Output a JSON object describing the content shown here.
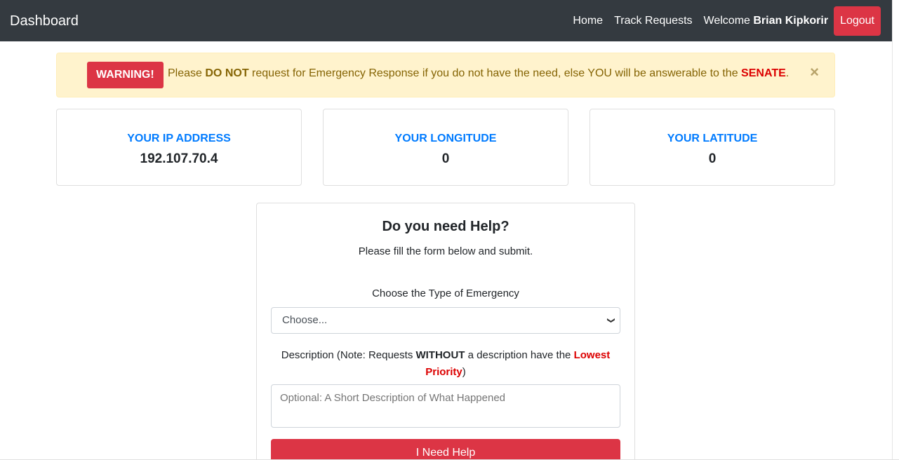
{
  "navbar": {
    "brand": "Dashboard",
    "home": "Home",
    "track": "Track Requests",
    "welcome_prefix": "Welcome",
    "user_name": "Brian Kipkorir",
    "logout": "Logout"
  },
  "alert": {
    "badge": "WARNING!",
    "text_1": "Please ",
    "emphasis_1": "DO NOT",
    "text_2": " request for Emergency Response if you do not have the need, else YOU will be answerable to the ",
    "emphasis_2": "SENATE",
    "text_3": ".",
    "close": "×"
  },
  "stats": [
    {
      "label": "YOUR IP ADDRESS",
      "value": "192.107.70.4"
    },
    {
      "label": "YOUR LONGITUDE",
      "value": "0"
    },
    {
      "label": "YOUR LATITUDE",
      "value": "0"
    }
  ],
  "form": {
    "title": "Do you need Help?",
    "subtitle": "Please fill the form below and submit.",
    "type_label": "Choose the Type of Emergency",
    "type_selected": "Choose...",
    "desc_prefix": "Description (Note: Requests ",
    "desc_bold": "WITHOUT",
    "desc_middle": " a description have the ",
    "desc_red": "Lowest Priority",
    "desc_suffix": ")",
    "desc_placeholder": "Optional: A Short Description of What Happened",
    "submit": "I Need Help"
  },
  "colors": {
    "navbar": "#343a40",
    "danger": "#dc3545",
    "primary": "#007bff",
    "warning_bg": "#fff3cd",
    "warning_text": "#856404"
  }
}
